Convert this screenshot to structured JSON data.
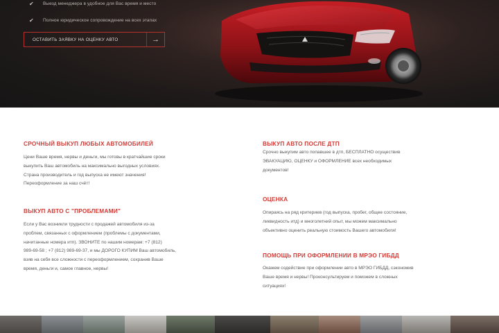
{
  "hero": {
    "features": [
      "Выезд менеджера в удобное для Вас время и место",
      "Полное юридическое сопровождение на всех этапах"
    ],
    "cta_label": "ОСТАВИТЬ ЗАЯВКУ НА ОЦЕНКУ АВТО",
    "cta_icon": "arrow-right-icon",
    "accent_color": "#b3322e"
  },
  "left": {
    "section1": {
      "title": "СРОЧНЫЙ ВЫКУП ЛЮБЫХ АВТОМОБИЛЕЙ",
      "lines": [
        "Цени Ваше время, нервы и деньги, мы готовы в кратчайшие сроки",
        "выкупить Ваш автомобиль на максимально выгодных условиях.",
        "Страна производитель и год выпуска не имеют значения!",
        "Переоформление за наш счёт!"
      ]
    },
    "section2": {
      "title": "ВЫКУП АВТО С \"ПРОБЛЕМАМИ\"",
      "lines": [
        "Если у Вас возникли трудности с продажей автомобиля из-за",
        "проблем, связанных с оформлением (проблемы с документами,",
        "начитанные номера итп). ЗВОНИТЕ по нашим номерам: +7 (812)",
        "989-69-58 ; +7 (812) 989-69-37, и мы ДОРОГО КУПИМ Ваш автомобиль,",
        "взяв на себя все сложности с переоформлением, сохранив Ваше",
        "время, деньги и, самое главное, нервы!"
      ]
    }
  },
  "right": {
    "section1": {
      "title": "ВЫКУП АВТО ПОСЛЕ ДТП",
      "lines": [
        "Срочно выкупим авто попавшее в дтп, БЕСПЛАТНО осуществив",
        "ЭВАКУАЦИЮ, ОЦЕНКУ и ОФОРМЛЕНИЕ всех необходимых",
        "документов!"
      ]
    },
    "section2": {
      "title": "ОЦЕНКА",
      "lines": [
        "Опираясь на ряд критериев (год выпуска, пробег, общее состояние,",
        "ликвидность итд) и многолетний опыт, мы можем максимально",
        "объективно оценить реальную стоимость Вашего автомобиля!"
      ]
    },
    "section3": {
      "title": "ПОМОЩЬ ПРИ ОФОРМЛЕНИИ В МРЭО ГИБДД",
      "lines": [
        "Окажем содействие при оформлении авто в МРЭО ГИБДД, сэкономив",
        "Ваше время и нервы! Проконсультируем и поможем в сложных",
        "ситуациях!"
      ]
    }
  }
}
